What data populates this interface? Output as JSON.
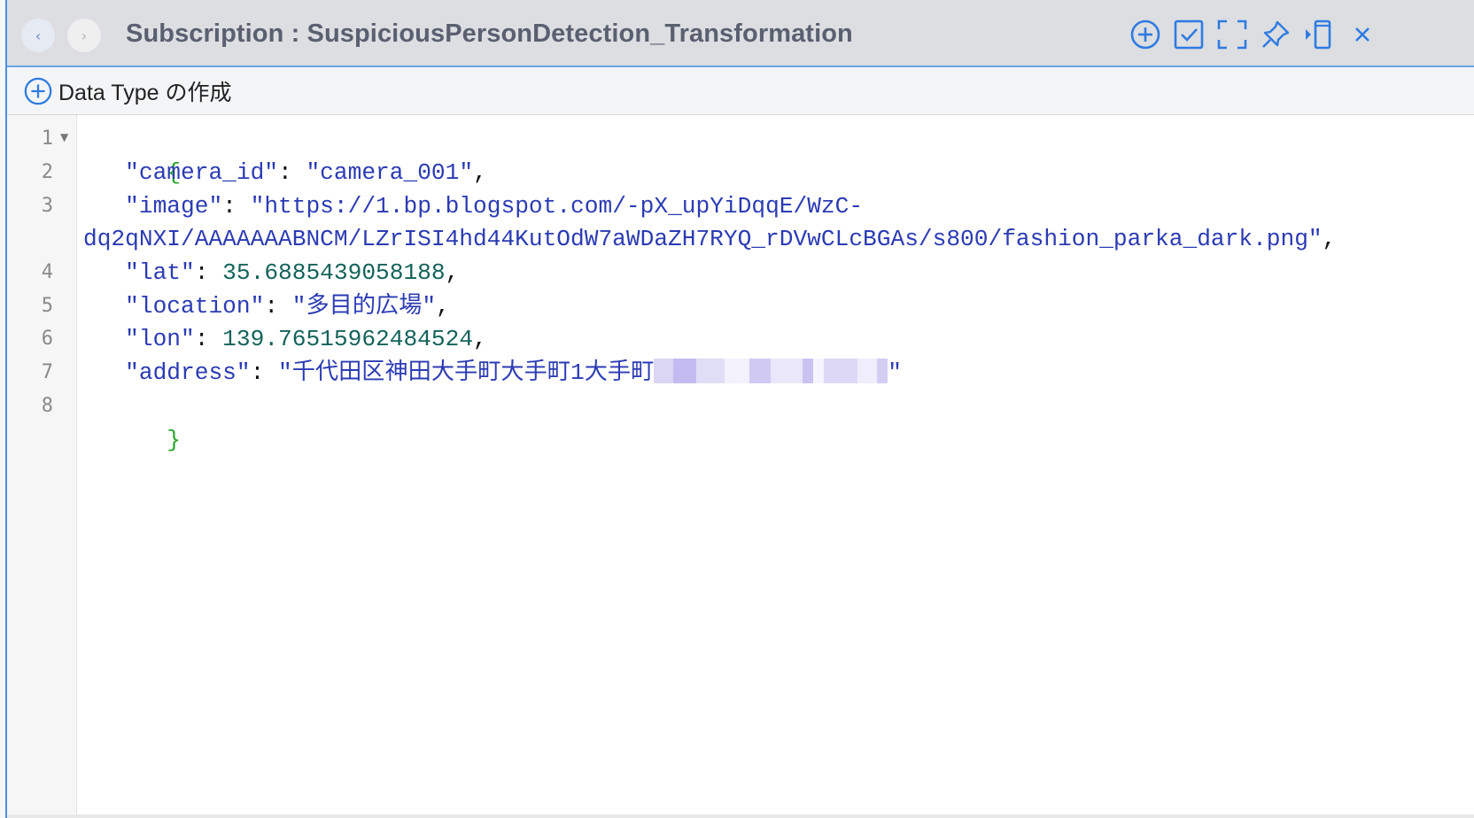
{
  "window": {
    "title": "Subscription : SuspiciousPersonDetection_Transformation",
    "nav": {
      "back_icon": "chevron-left-icon",
      "forward_icon": "chevron-right-icon"
    },
    "tools": [
      "add-circle-icon",
      "check-square-icon",
      "expand-icon",
      "pin-icon",
      "split-panel-icon",
      "close-icon"
    ],
    "accent_color": "#2f7be0"
  },
  "toolbar": {
    "create_label": "Data Type の作成",
    "create_icon": "add-circle-icon"
  },
  "editor": {
    "line_numbers": [
      "1",
      "2",
      "3",
      "",
      "4",
      "5",
      "6",
      "7",
      "8"
    ],
    "lines": {
      "l1": "{",
      "l2_key": "\"camera_id\"",
      "l2_val": "\"camera_001\"",
      "l3_key": "\"image\"",
      "l3_val_a": "\"https://1.bp.blogspot.com/-pX_upYiDqqE/WzC-",
      "l3_val_b": "dq2qNXI/AAAAAAABNCM/LZrISI4hd44KutOdW7aWDaZH7RYQ_rDVwCLcBGAs/s800/fashion_parka_dark.png\"",
      "l4_key": "\"lat\"",
      "l4_val": "35.6885439058188",
      "l5_key": "\"location\"",
      "l5_val": "\"多目的広場\"",
      "l6_key": "\"lon\"",
      "l6_val": "139.76515962484524",
      "l7_key": "\"address\"",
      "l7_val": "\"千代田区神田大手町大手町1大手町",
      "l7_end": "\"",
      "l8": "}"
    },
    "colors": {
      "brace": "#2aa52a",
      "string": "#2b3bb4",
      "number": "#14635a"
    }
  }
}
